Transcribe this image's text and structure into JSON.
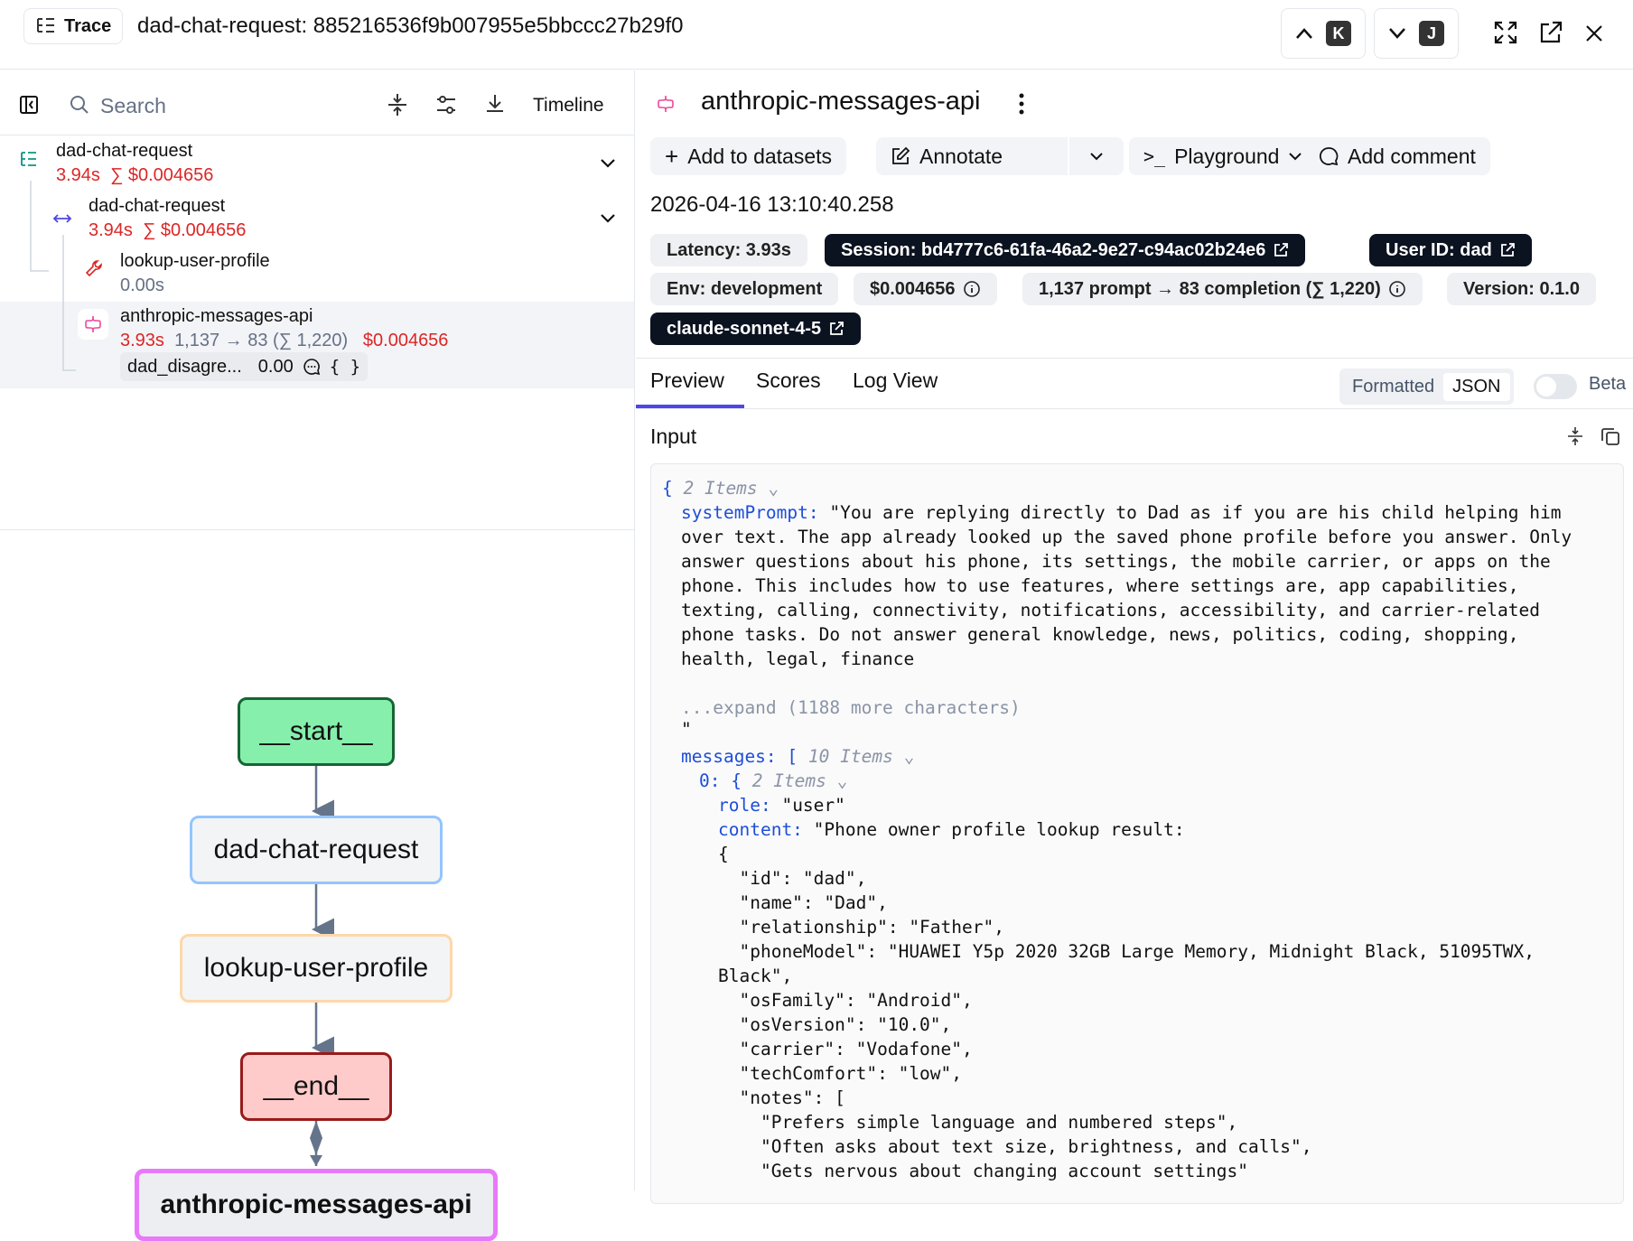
{
  "header": {
    "badge": "Trace",
    "title": "dad-chat-request: 885216536f9b007955e5bbccc27b29f0",
    "prev_key": "K",
    "next_key": "J"
  },
  "left": {
    "search_placeholder": "Search",
    "timeline_label": "Timeline",
    "tree": [
      {
        "name": "dad-chat-request",
        "latency": "3.94s",
        "cost": "∑ $0.004656"
      },
      {
        "name": "dad-chat-request",
        "latency": "3.94s",
        "cost": "∑ $0.004656"
      },
      {
        "name": "lookup-user-profile",
        "latency": "0.00s"
      },
      {
        "name": "anthropic-messages-api",
        "latency": "3.93s",
        "tokens": "1,137 → 83 (∑ 1,220)",
        "cost": "$0.004656",
        "score_name": "dad_disagre...",
        "score_value": "0.00"
      }
    ],
    "graph": [
      "__start__",
      "dad-chat-request",
      "lookup-user-profile",
      "__end__",
      "anthropic-messages-api"
    ]
  },
  "right": {
    "title": "anthropic-messages-api",
    "buttons": {
      "add_datasets": "Add to datasets",
      "annotate": "Annotate",
      "playground": "Playground",
      "comment": "Add comment"
    },
    "timestamp": "2026-04-16 13:10:40.258",
    "tags": {
      "latency": "Latency: 3.93s",
      "session": "Session: bd4777c6-61fa-46a2-9e27-c94ac02b24e6",
      "user": "User ID: dad",
      "env": "Env: development",
      "cost": "$0.004656",
      "tokens": "1,137 prompt → 83 completion (∑ 1,220)",
      "version": "Version: 0.1.0",
      "model": "claude-sonnet-4-5"
    },
    "tabs": [
      "Preview",
      "Scores",
      "Log View"
    ],
    "format_options": [
      "Formatted",
      "JSON"
    ],
    "beta_label": "Beta",
    "input_label": "Input",
    "code": {
      "root_items": "2 Items",
      "system_key": "systemPrompt:",
      "system_lines": [
        "\"You are replying directly to Dad as if you are his child helping him",
        "over text. The app already looked up the saved phone profile before you answer. Only",
        "answer questions about his phone, its settings, the mobile carrier, or apps on the",
        "phone. This includes how to use features, where settings are, app capabilities,",
        "texting, calling, connectivity, notifications, accessibility, and carrier-related",
        "phone tasks. Do not answer general knowledge, news, politics, coding, shopping,",
        "health, legal, finance"
      ],
      "expand": "...expand (1188 more characters)",
      "quote": "\"",
      "messages_key": "messages:",
      "messages_items": "10 Items",
      "msg0_key": "0:",
      "msg0_items": "2 Items",
      "role_key": "role:",
      "role_val": "\"user\"",
      "content_key": "content:",
      "content_lines": [
        "\"Phone owner profile lookup result:",
        "{",
        "  \"id\": \"dad\",",
        "  \"name\": \"Dad\",",
        "  \"relationship\": \"Father\",",
        "  \"phoneModel\": \"HUAWEI Y5p 2020 32GB Large Memory, Midnight Black, 51095TWX,",
        "Black\",",
        "  \"osFamily\": \"Android\",",
        "  \"osVersion\": \"10.0\",",
        "  \"carrier\": \"Vodafone\",",
        "  \"techComfort\": \"low\",",
        "  \"notes\": [",
        "    \"Prefers simple language and numbered steps\",",
        "    \"Often asks about text size, brightness, and calls\",",
        "    \"Gets nervous about changing account settings\""
      ]
    }
  }
}
